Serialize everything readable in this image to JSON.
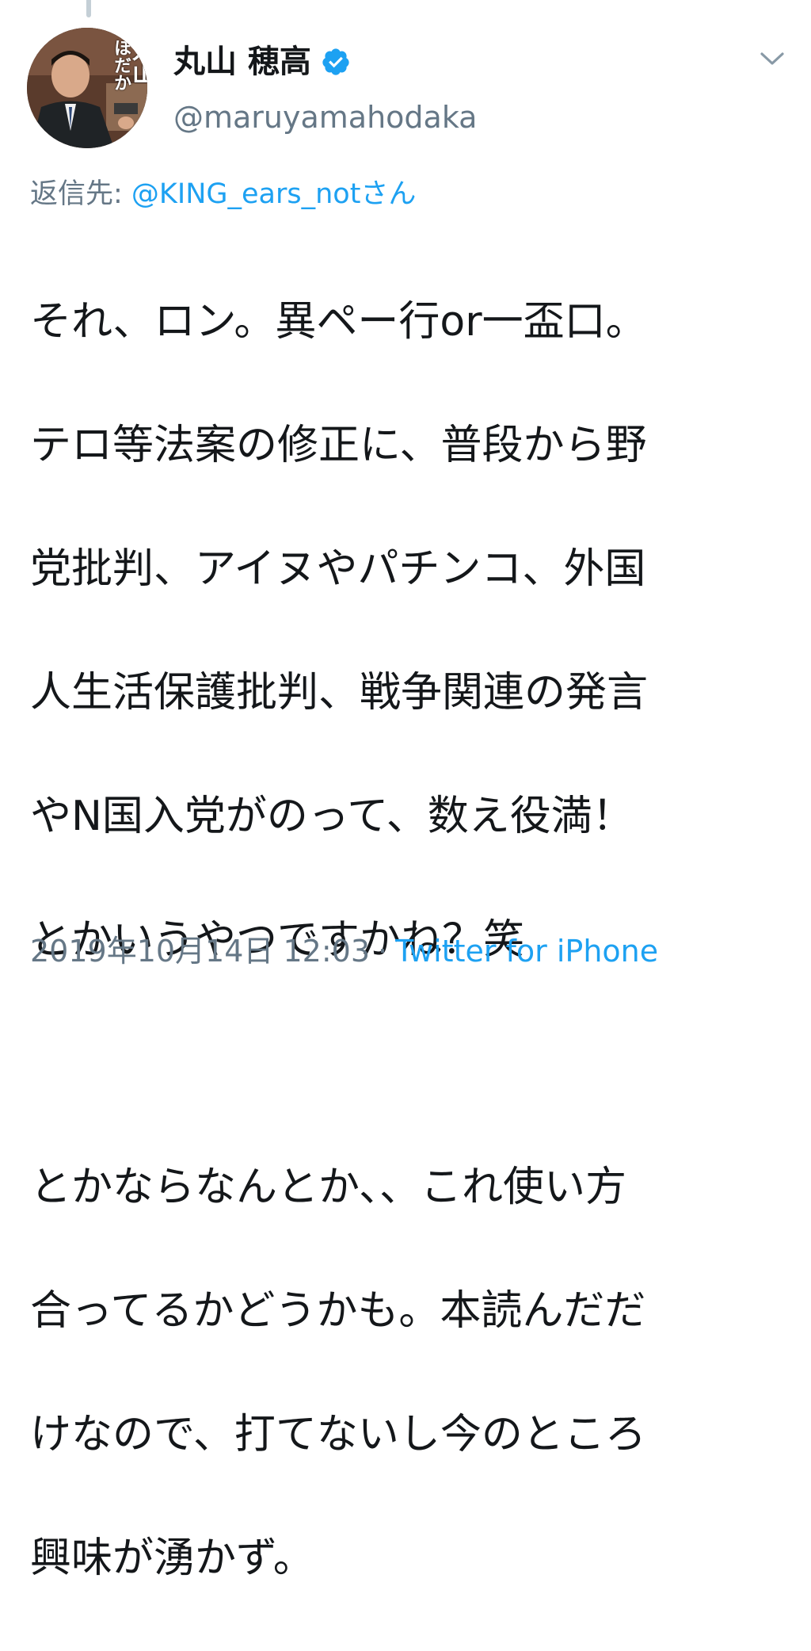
{
  "tweet": {
    "display_name": "丸山 穂高",
    "handle": "@maruyamahodaka",
    "avatar_text_small": "ほだか",
    "avatar_text_big": "丸山",
    "reply_prefix": "返信先: ",
    "reply_target": "@KING_ears_notさん",
    "lines": [
      "それ、ロン。異ペー行or一盃口。",
      "テロ等法案の修正に、普段から野",
      "党批判、アイヌやパチンコ、外国",
      "人生活保護批判、戦争関連の発言",
      "やN国入党がのって、数え役満！",
      "とかいうやつですかね？笑",
      "",
      "とかならなんとか、、これ使い方",
      "合ってるかどうかも。本読んだだ",
      "けなので、打てないし今のところ",
      "興味が湧かず。"
    ],
    "timestamp": "2019年10月14日 12:03",
    "separator": "·",
    "source": "Twitter for iPhone"
  },
  "colors": {
    "text": "#14171a",
    "secondary": "#657786",
    "accent": "#1da1f2"
  },
  "icons": {
    "verified": "verified-badge-icon",
    "menu": "chevron-down-icon"
  }
}
